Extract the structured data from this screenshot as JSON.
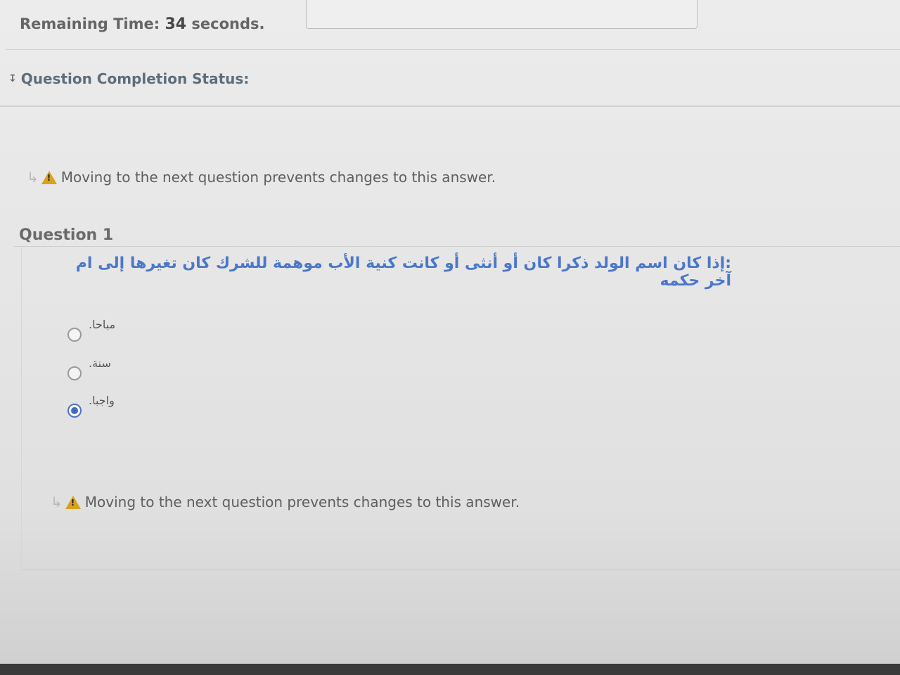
{
  "timer": {
    "label": "Remaining Time:",
    "value": "34",
    "unit": "seconds."
  },
  "completion_status": {
    "label": "Question Completion Status:",
    "icon": "chevron-down-icon"
  },
  "notice": {
    "text": "Moving to the next question prevents changes to this answer.",
    "icon": "warning-icon",
    "arrow_icon": "arrow-right-icon"
  },
  "question": {
    "title": "Question 1",
    "text": ":إذا كان اسم الولد ذكرا كان أو أنثى أو كانت كنية الأب موهمة للشرك كان تغيرها إلى ام آخر حكمه",
    "options": [
      {
        "label": "مباحا.",
        "selected": false
      },
      {
        "label": "سنة.",
        "selected": false
      },
      {
        "label": "واجبا.",
        "selected": true
      }
    ]
  },
  "colors": {
    "question_text": "#4b77c8",
    "warning": "#d9a21b",
    "selected_radio": "#3e6cc2"
  }
}
